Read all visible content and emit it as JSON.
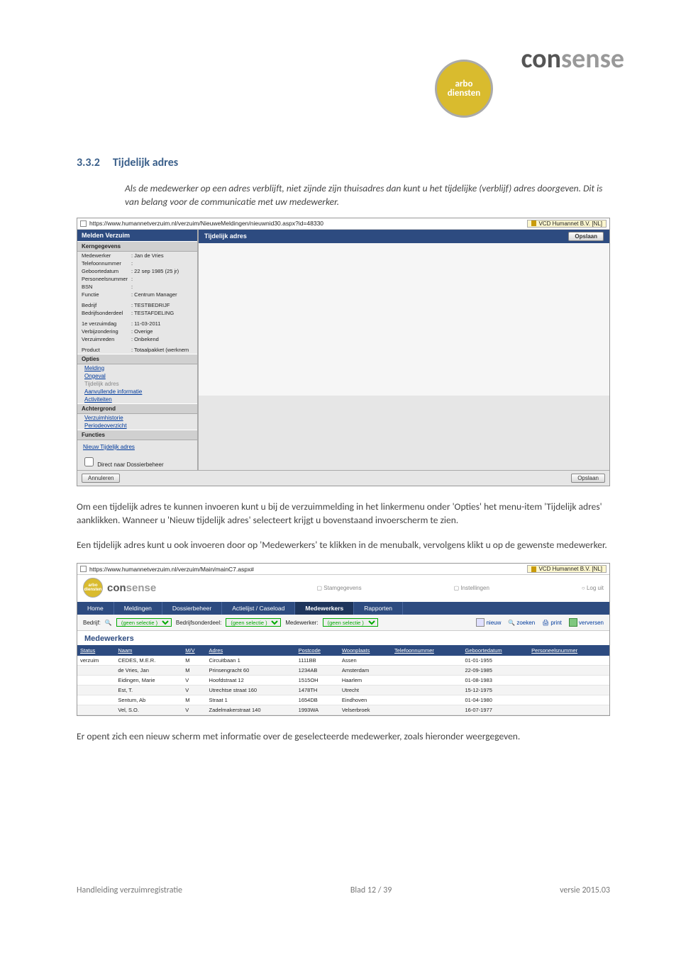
{
  "header": {
    "brand_left": "con",
    "brand_right": "sense",
    "circle_top": "arbo",
    "circle_bottom": "diensten"
  },
  "section": {
    "number": "3.3.2",
    "title": "Tijdelijk adres"
  },
  "intro": "Als de medewerker op een adres verblijft, niet zijnde zijn thuisadres dan kunt u het tijdelijke (verblijf) adres doorgeven. Dit is van belang voor de communicatie met uw medewerker.",
  "screenshot1": {
    "url": "https://www.humannetverzuim.nl/verzuim/NieuweMeldingen/nieuwnid30.aspx?id=48330",
    "cert": "VCD Humannet B.V. [NL]",
    "side_title": "Melden Verzuim",
    "sect_kern": "Kerngegevens",
    "kv": [
      {
        "k": "Medewerker",
        "v": "Jan de Vries"
      },
      {
        "k": "Telefoonnummer",
        "v": ""
      },
      {
        "k": "Geboortedatum",
        "v": "22 sep 1985 (25 jr)"
      },
      {
        "k": "Personeelsnummer",
        "v": ""
      },
      {
        "k": "BSN",
        "v": ""
      },
      {
        "k": "Functie",
        "v": "Centrum Manager"
      }
    ],
    "kv2": [
      {
        "k": "Bedrijf",
        "v": "TESTBEDRIJF"
      },
      {
        "k": "Bedrijfsonderdeel",
        "v": "TESTAFDELING"
      }
    ],
    "kv3": [
      {
        "k": "1e verzuimdag",
        "v": "11-03-2011"
      },
      {
        "k": "Verbijzondering",
        "v": "Overige"
      },
      {
        "k": "Verzuimreden",
        "v": "Onbekend"
      }
    ],
    "kv4": [
      {
        "k": "Product",
        "v": "Totaalpakket (werknem"
      }
    ],
    "sect_opties": "Opties",
    "opt_melding": "Melding",
    "opt_ongeval": "Ongeval",
    "opt_tijd": "Tijdelijk adres",
    "opt_aanv": "Aanvullende informatie",
    "opt_act": "Activiteiten",
    "sect_acht": "Achtergrond",
    "opt_hist": "Verzuimhistorie",
    "opt_perio": "Periodeoverzicht",
    "sect_func": "Functies",
    "func_nieuw": "Nieuw Tijdelijk adres",
    "chk_direct": "Direct naar Dossierbeheer",
    "right_title": "Tijdelijk adres",
    "btn_opslaan": "Opslaan",
    "btn_annuleren": "Annuleren"
  },
  "para2": "Om een tijdelijk adres te kunnen invoeren kunt u bij de verzuimmelding in het linkermenu onder 'Opties' het menu-item 'Tijdelijk adres' aanklikken. Wanneer u 'Nieuw tijdelijk adres' selecteert krijgt u bovenstaand invoerscherm te zien.",
  "para3": "Een tijdelijk adres kunt u ook invoeren door op 'Medewerkers' te klikken in de menubalk, vervolgens klikt u op de gewenste medewerker.",
  "screenshot2": {
    "url": "https://www.humannetverzuim.nl/verzuim/Main/mainC7.aspx#",
    "cert": "VCD Humannet B.V. [NL]",
    "top_stam": "Stamgegevens",
    "top_inst": "Instellingen",
    "top_logout": "Log uit",
    "nav": [
      "Home",
      "Meldingen",
      "Dossierbeheer",
      "Actielijst / Caseload",
      "Medewerkers",
      "Rapporten"
    ],
    "nav_active": 4,
    "filter_bedrijf": "Bedrijf:",
    "filter_bo": "Bedrijfsonderdeel:",
    "filter_mw": "Medewerker:",
    "filter_sel": "(geen selectie )",
    "action_nieuw": "nieuw",
    "action_zoeken": "zoeken",
    "action_print": "print",
    "action_ververs": "verversen",
    "table_title": "Medewerkers",
    "headers": [
      "Status",
      "Naam",
      "M/V",
      "Adres",
      "Postcode",
      "Woonplaats",
      "Telefoonnummer",
      "Geboortedatum",
      "Personeelsnummer"
    ],
    "rows": [
      {
        "status": "verzuim",
        "naam": "CEDES, M.E.R.",
        "mv": "M",
        "adres": "Circuitbaan 1",
        "pc": "1111BB",
        "wp": "Assen",
        "tel": "",
        "geb": "01-01-1955",
        "pn": ""
      },
      {
        "status": "",
        "naam": "de Vries, Jan",
        "mv": "M",
        "adres": "Prinsengracht 60",
        "pc": "1234AB",
        "wp": "Amsterdam",
        "tel": "",
        "geb": "22-09-1985",
        "pn": ""
      },
      {
        "status": "",
        "naam": "Eidingen, Marie",
        "mv": "V",
        "adres": "Hoofdstraat 12",
        "pc": "1515OH",
        "wp": "Haarlem",
        "tel": "",
        "geb": "01-08-1983",
        "pn": ""
      },
      {
        "status": "",
        "naam": "Est, T.",
        "mv": "V",
        "adres": "Utrechtse straat 160",
        "pc": "1478TH",
        "wp": "Utrecht",
        "tel": "",
        "geb": "15-12-1975",
        "pn": ""
      },
      {
        "status": "",
        "naam": "Sentum, Ab",
        "mv": "M",
        "adres": "Straat 1",
        "pc": "1654DB",
        "wp": "Eindhoven",
        "tel": "",
        "geb": "01-04-1980",
        "pn": ""
      },
      {
        "status": "",
        "naam": "Vel, S.O.",
        "mv": "V",
        "adres": "Zadelmakerstraat 140",
        "pc": "1993WA",
        "wp": "Velserbroek",
        "tel": "",
        "geb": "16-07-1977",
        "pn": ""
      }
    ]
  },
  "para4": "Er opent zich een nieuw scherm met informatie over de geselecteerde medewerker, zoals hieronder weergegeven.",
  "footer": {
    "left": "Handleiding verzuimregistratie",
    "mid": "Blad 12 / 39",
    "right": "versie 2015.03"
  }
}
